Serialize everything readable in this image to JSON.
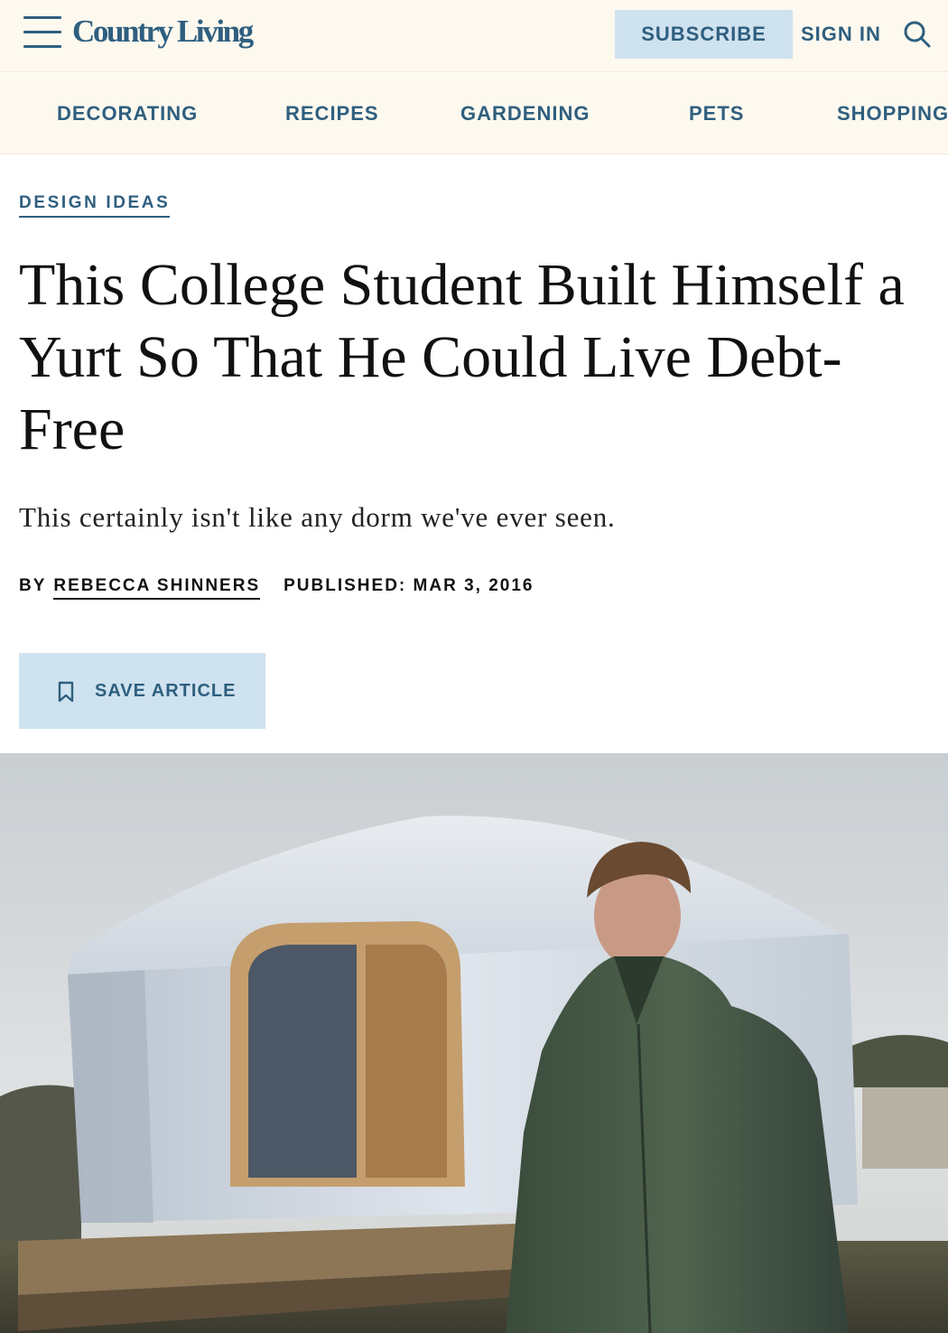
{
  "header": {
    "logo": "Country Living",
    "subscribe_label": "SUBSCRIBE",
    "signin_label": "SIGN IN",
    "menu_icon": "hamburger-menu-icon",
    "search_icon": "search-icon"
  },
  "nav": {
    "items": [
      {
        "label": "DECORATING"
      },
      {
        "label": "RECIPES"
      },
      {
        "label": "GARDENING"
      },
      {
        "label": "PETS"
      },
      {
        "label": "SHOPPING"
      }
    ]
  },
  "article": {
    "kicker": "DESIGN IDEAS",
    "title": "This College Student Built Himself a Yurt So That He Could Live Debt-Free",
    "dek": "This certainly isn't like any dorm we've ever seen.",
    "byline_prefix": "BY",
    "author": "REBECCA SHINNERS",
    "published": "PUBLISHED: MAR 3, 2016",
    "save_label": "SAVE ARTICLE",
    "save_icon": "bookmark-icon"
  },
  "colors": {
    "brand": "#2f5f7f",
    "header_bg": "#fdf9ef",
    "button_bg": "#cfe2ef"
  }
}
